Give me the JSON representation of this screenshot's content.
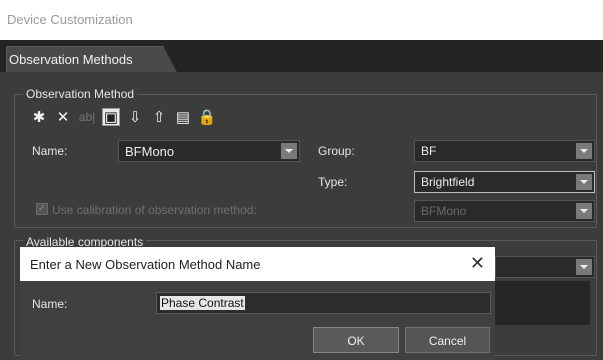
{
  "window": {
    "title": "Device Customization"
  },
  "tabs": [
    {
      "label": "Observation Methods"
    }
  ],
  "observation_method": {
    "group_label": "Observation Method",
    "toolbar": [
      {
        "icon": "asterisk-icon",
        "glyph": "✱"
      },
      {
        "icon": "delete-icon",
        "glyph": "✕"
      },
      {
        "icon": "rename-icon",
        "glyph": "ab|"
      },
      {
        "icon": "copy-icon",
        "glyph": "▣"
      },
      {
        "icon": "import-icon",
        "glyph": "⇩"
      },
      {
        "icon": "export-icon",
        "glyph": "⇧"
      },
      {
        "icon": "settings-icon",
        "glyph": "▤"
      },
      {
        "icon": "lock-icon",
        "glyph": "🔒"
      }
    ],
    "name_label": "Name:",
    "name_value": "BFMono",
    "group_field_label": "Group:",
    "group_value": "BF",
    "type_label": "Type:",
    "type_value": "Brightfield",
    "calibration_label": "Use calibration of observation method:",
    "calibration_value": "BFMono"
  },
  "available_components": {
    "group_label": "Available components"
  },
  "dialog": {
    "title": "Enter a New Observation Method Name",
    "name_label": "Name:",
    "name_value": "Phase Contrast",
    "ok_label": "OK",
    "cancel_label": "Cancel"
  }
}
